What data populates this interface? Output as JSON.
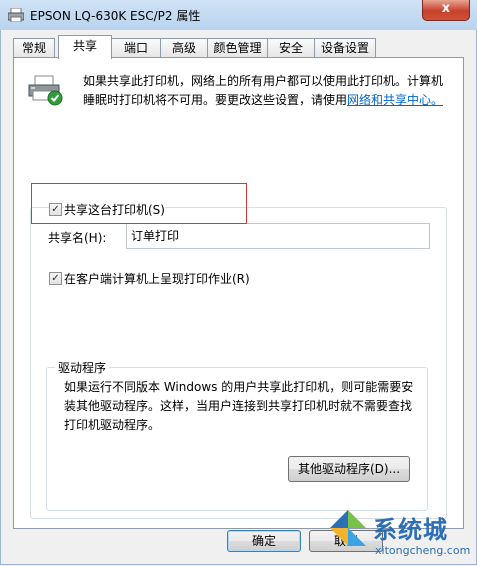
{
  "window": {
    "title": "EPSON LQ-630K ESC/P2 属性",
    "close_glyph": "x"
  },
  "tabs": [
    {
      "label": "常规"
    },
    {
      "label": "共享",
      "active": true
    },
    {
      "label": "端口"
    },
    {
      "label": "高级"
    },
    {
      "label": "颜色管理"
    },
    {
      "label": "安全"
    },
    {
      "label": "设备设置"
    }
  ],
  "sharing": {
    "description": "如果共享此打印机，网络上的所有用户都可以使用此打印机。计算机睡眠时打印机将不可用。要更改这些设置，请使用",
    "link_text": "网络和共享中心。",
    "share_checkbox": {
      "label": "共享这台打印机(S)",
      "checked": true
    },
    "share_name_label": "共享名(H):",
    "share_name_value": "订单打印",
    "render_checkbox": {
      "label": "在客户端计算机上呈现打印作业(R)",
      "checked": true
    },
    "checkmark_glyph": "✓"
  },
  "drivers": {
    "title": "驱动程序",
    "description": "如果运行不同版本 Windows 的用户共享此打印机，则可能需要安装其他驱动程序。这样，当用户连接到共享打印机时就不需要查找打印机驱动程序。",
    "button_label": "其他驱动程序(D)..."
  },
  "footer": {
    "ok_label": "确定",
    "cancel_label": "取消"
  },
  "watermark": {
    "text": "系统城",
    "url": "xitongcheng.com"
  },
  "colors": {
    "link": "#0066cc",
    "highlight_box": "#d23a3a",
    "watermark": "#2d6fb5"
  },
  "icons": [
    "printer-icon",
    "check-icon",
    "watermark-logo-icon"
  ]
}
